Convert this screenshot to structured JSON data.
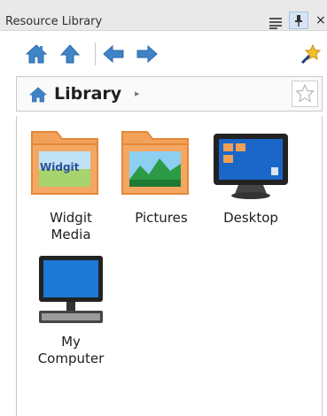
{
  "window": {
    "title": "Resource Library"
  },
  "toolbar": {
    "home_icon": "home-icon",
    "up_icon": "up-arrow-icon",
    "back_icon": "back-arrow-icon",
    "forward_icon": "forward-arrow-icon",
    "favorites_icon": "pin-star-icon"
  },
  "address": {
    "label": "Library",
    "arrow": "▸"
  },
  "items": [
    {
      "label": "Widgit\nMedia",
      "icon": "widgit-folder-icon",
      "folder_text": "Widgit"
    },
    {
      "label": "Pictures",
      "icon": "pictures-folder-icon"
    },
    {
      "label": "Desktop",
      "icon": "desktop-monitor-icon"
    },
    {
      "label": "My\nComputer",
      "icon": "computer-icon"
    }
  ],
  "colors": {
    "folder": "#f1a15a",
    "folder_border": "#e48838",
    "arrow_blue": "#3f84c7",
    "monitor_screen": "#1a66c9",
    "monitor_frame": "#222222"
  },
  "title_close": "×"
}
